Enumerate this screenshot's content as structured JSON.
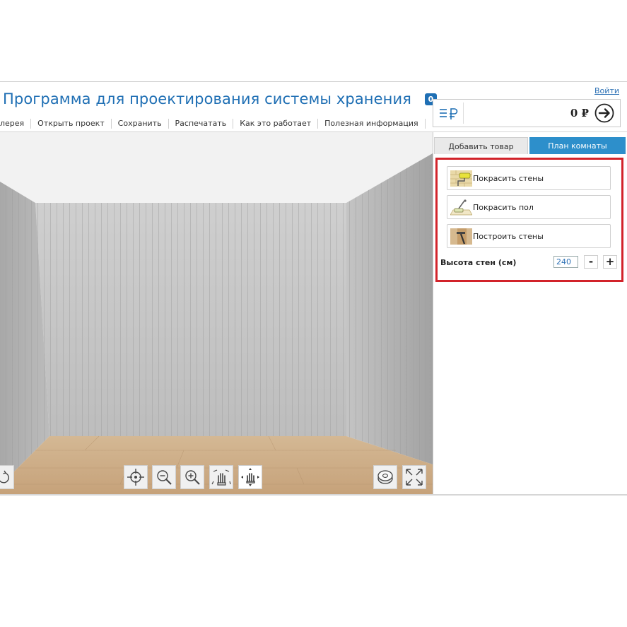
{
  "header": {
    "title": "Программа для проектирования системы хранения",
    "login_link": "Войти"
  },
  "menu": {
    "items": [
      {
        "label": "лерея"
      },
      {
        "label": "Открыть проект"
      },
      {
        "label": "Сохранить"
      },
      {
        "label": "Распечатать"
      },
      {
        "label": "Как это работает"
      },
      {
        "label": "Полезная информация"
      }
    ]
  },
  "cart": {
    "badge_count": "0",
    "total": "0 ₽",
    "list_icon": "list-ruble-icon",
    "go_icon": "arrow-right-circle-icon"
  },
  "tabs": [
    {
      "label": "Добавить товар",
      "active": false
    },
    {
      "label": "План комнаты",
      "active": true
    }
  ],
  "room_plan": {
    "actions": [
      {
        "label": "Покрасить стены",
        "icon": "paint-roller-icon"
      },
      {
        "label": "Покрасить пол",
        "icon": "paint-floor-icon"
      },
      {
        "label": "Построить стены",
        "icon": "hammer-icon"
      }
    ],
    "wall_height_label": "Высота стен (см)",
    "wall_height_value": "240",
    "decrement_label": "-",
    "increment_label": "+"
  },
  "toolbar": {
    "left_icon": "rotate-icon",
    "tools": [
      "target-center-icon",
      "zoom-out-icon",
      "zoom-in-icon",
      "pan-hand-icon",
      "move-hand-icon"
    ],
    "right_tools": [
      "tape-measure-icon",
      "fullscreen-icon"
    ]
  },
  "colors": {
    "accent": "#1f6fb4",
    "active_tab": "#2d8fcb",
    "highlight": "#d2232a"
  }
}
